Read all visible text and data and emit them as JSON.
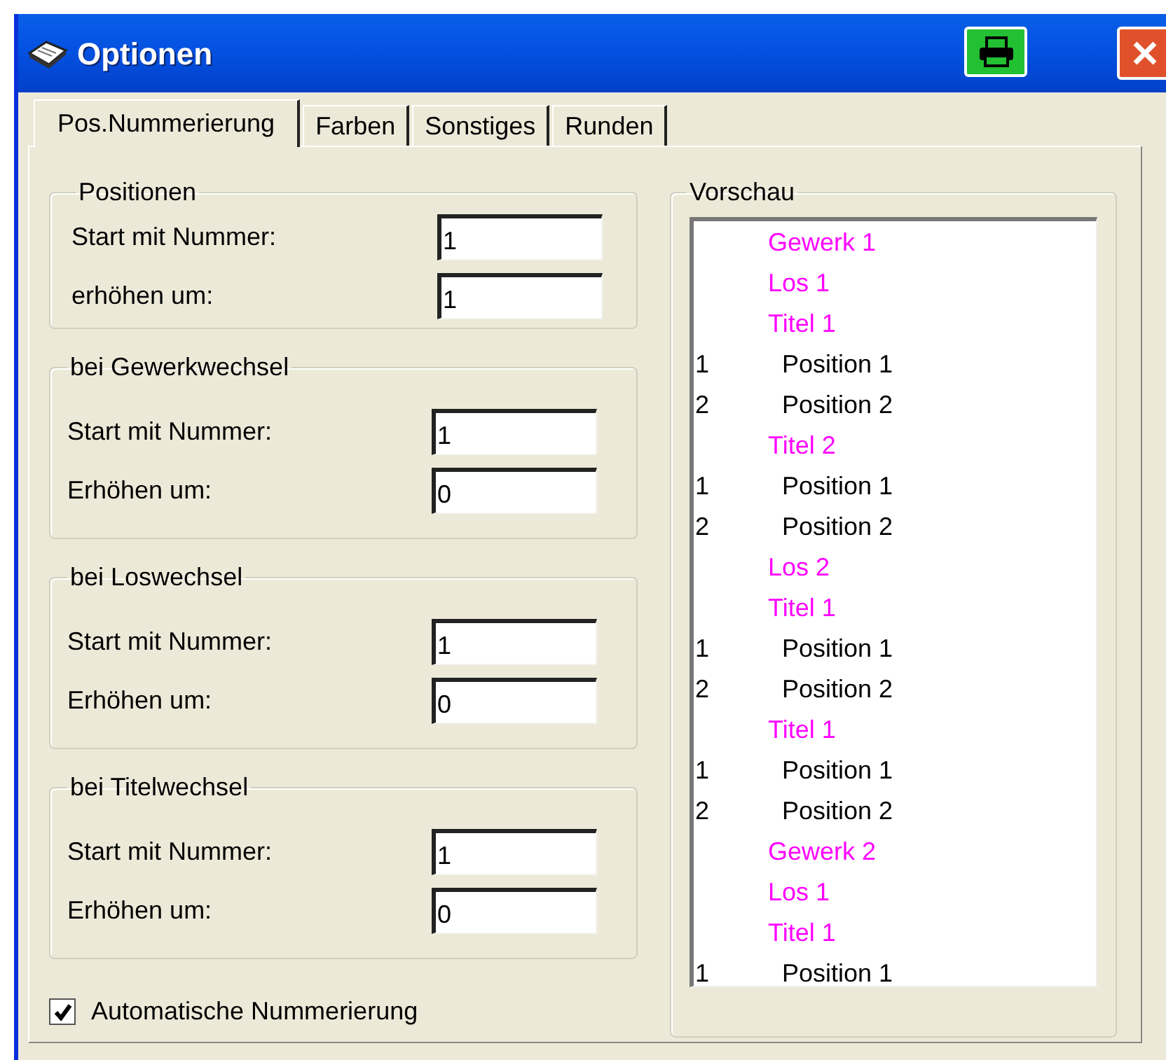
{
  "window": {
    "title": "Optionen"
  },
  "tabs": [
    {
      "label": "Pos.Nummerierung",
      "selected": true
    },
    {
      "label": "Farben",
      "selected": false
    },
    {
      "label": "Sonstiges",
      "selected": false
    },
    {
      "label": "Runden",
      "selected": false
    }
  ],
  "groups": [
    {
      "title": "Positionen",
      "fields": [
        {
          "label": "Start mit Nummer:",
          "value": "1"
        },
        {
          "label": "erhöhen um:",
          "value": "1"
        }
      ]
    },
    {
      "title": "bei Gewerkwechsel",
      "fields": [
        {
          "label": "Start mit Nummer:",
          "value": "1"
        },
        {
          "label": "Erhöhen um:",
          "value": "0"
        }
      ]
    },
    {
      "title": "bei Loswechsel",
      "fields": [
        {
          "label": "Start mit Nummer:",
          "value": "1"
        },
        {
          "label": "Erhöhen um:",
          "value": "0"
        }
      ]
    },
    {
      "title": "bei Titelwechsel",
      "fields": [
        {
          "label": "Start mit Nummer:",
          "value": "1"
        },
        {
          "label": "Erhöhen um:",
          "value": "0"
        }
      ]
    }
  ],
  "auto_numbering": {
    "label": "Automatische Nummerierung",
    "checked": true
  },
  "preview": {
    "title": "Vorschau",
    "rows": [
      {
        "kind": "heading",
        "text": "Gewerk 1"
      },
      {
        "kind": "heading",
        "text": "Los 1"
      },
      {
        "kind": "heading",
        "text": "Titel 1"
      },
      {
        "kind": "position",
        "number": "1",
        "text": "Position 1"
      },
      {
        "kind": "position",
        "number": "2",
        "text": "Position 2"
      },
      {
        "kind": "heading",
        "text": "Titel 2"
      },
      {
        "kind": "position",
        "number": "1",
        "text": "Position 1"
      },
      {
        "kind": "position",
        "number": "2",
        "text": "Position 2"
      },
      {
        "kind": "heading",
        "text": "Los 2"
      },
      {
        "kind": "heading",
        "text": "Titel 1"
      },
      {
        "kind": "position",
        "number": "1",
        "text": "Position 1"
      },
      {
        "kind": "position",
        "number": "2",
        "text": "Position 2"
      },
      {
        "kind": "heading",
        "text": "Titel 1"
      },
      {
        "kind": "position",
        "number": "1",
        "text": "Position 1"
      },
      {
        "kind": "position",
        "number": "2",
        "text": "Position 2"
      },
      {
        "kind": "heading",
        "text": "Gewerk 2"
      },
      {
        "kind": "heading",
        "text": "Los 1"
      },
      {
        "kind": "heading",
        "text": "Titel 1"
      },
      {
        "kind": "position",
        "number": "1",
        "text": "Position 1"
      }
    ]
  }
}
